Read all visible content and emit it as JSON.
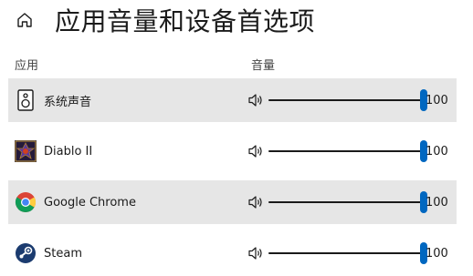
{
  "header": {
    "title": "应用音量和设备首选项"
  },
  "columns": {
    "app": "应用",
    "volume": "音量"
  },
  "rows": [
    {
      "name": "系统声音",
      "icon": "system-sounds-icon",
      "volume": 100
    },
    {
      "name": "Diablo II",
      "icon": "diablo-ii-icon",
      "volume": 100
    },
    {
      "name": "Google Chrome",
      "icon": "chrome-icon",
      "volume": 100
    },
    {
      "name": "Steam",
      "icon": "steam-icon",
      "volume": 100
    }
  ],
  "colors": {
    "accent": "#0067c0",
    "row_shade": "#e6e6e6"
  }
}
